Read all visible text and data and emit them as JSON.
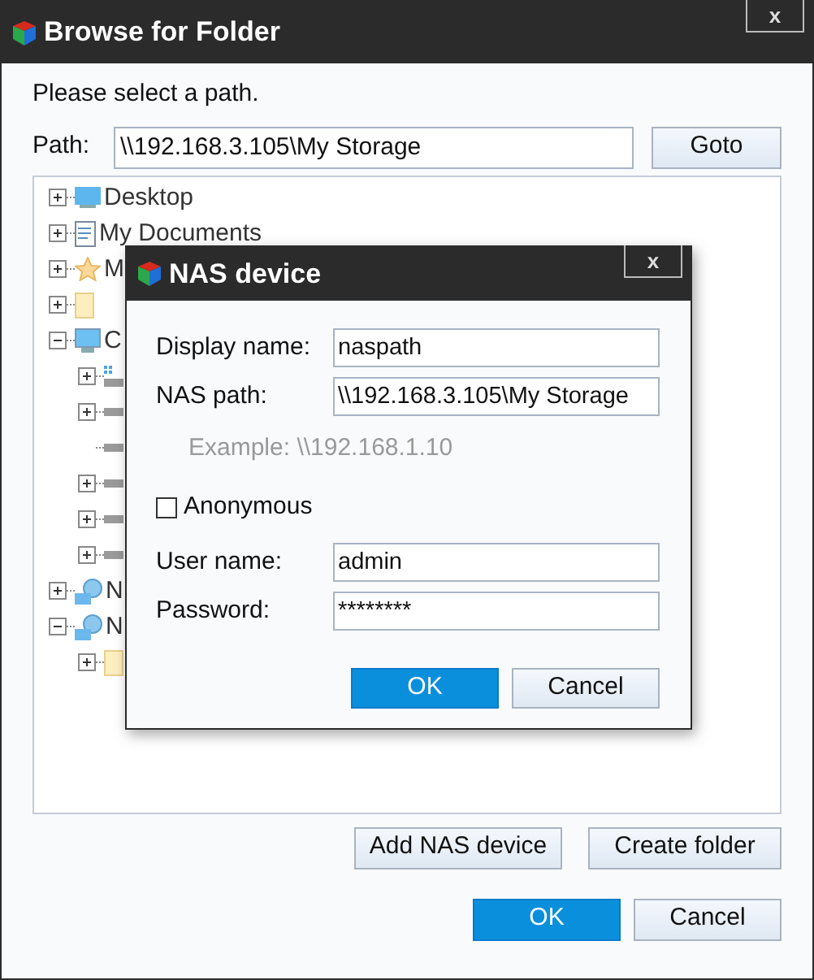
{
  "window": {
    "title": "Browse for Folder",
    "close": "x"
  },
  "prompt": "Please select a path.",
  "path": {
    "label": "Path:",
    "value": "\\\\192.168.3.105\\My Storage"
  },
  "goto_button": "Goto",
  "tree": [
    {
      "kind": "desktop",
      "label": "Desktop",
      "expanded": false
    },
    {
      "kind": "document",
      "label": "My Documents",
      "expanded": false
    },
    {
      "kind": "star",
      "label": "M",
      "expanded": false
    },
    {
      "kind": "folder",
      "expanded": false
    },
    {
      "kind": "computer",
      "label": "C",
      "expanded": true,
      "children": [
        {
          "kind": "system-drive",
          "expanded": false
        },
        {
          "kind": "drive",
          "expanded": false
        },
        {
          "kind": "drive"
        },
        {
          "kind": "drive",
          "expanded": false
        },
        {
          "kind": "drive",
          "expanded": false
        },
        {
          "kind": "drive",
          "expanded": false
        }
      ]
    },
    {
      "kind": "network",
      "label": "N",
      "expanded": false
    },
    {
      "kind": "network",
      "label": "N",
      "expanded": true,
      "children": [
        {
          "kind": "folder",
          "expanded": false
        }
      ]
    }
  ],
  "buttons": {
    "add_nas": "Add NAS device",
    "create_folder": "Create folder",
    "ok": "OK",
    "cancel": "Cancel"
  },
  "dialog": {
    "title": "NAS device",
    "close": "x",
    "fields": [
      {
        "label": "Display name:",
        "value": "naspath"
      },
      {
        "label": "NAS path:",
        "value": "\\\\192.168.3.105\\My Storage"
      },
      {
        "label": "User name:",
        "value": "admin"
      },
      {
        "label": "Password:",
        "value": "********"
      }
    ],
    "example": "Example: \\\\192.168.1.10",
    "anonymous": {
      "label": "Anonymous",
      "checked": false
    },
    "ok": "OK",
    "cancel": "Cancel"
  }
}
